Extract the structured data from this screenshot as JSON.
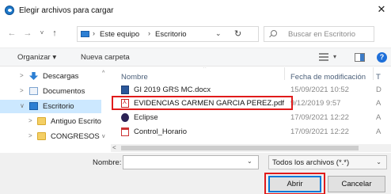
{
  "window": {
    "title": "Elegir archivos para cargar",
    "close_glyph": "✕",
    "icon": "chrome-icon"
  },
  "navigation": {
    "back_glyph": "←",
    "forward_glyph": "→",
    "recent_glyph": "˅",
    "up_glyph": "↑",
    "breadcrumb": [
      "Este equipo",
      "Escritorio"
    ],
    "separator": "›",
    "dropdown_glyph": "⌄",
    "refresh_glyph": "↻",
    "search_placeholder": "Buscar en Escritorio"
  },
  "toolbar": {
    "organize": "Organizar ▾",
    "new_folder": "Nueva carpeta",
    "view_dropdown": "▾",
    "help": "?"
  },
  "sidebar": {
    "items": [
      {
        "label": "Descargas",
        "icon": "download-icon"
      },
      {
        "label": "Documentos",
        "icon": "documents-icon"
      },
      {
        "label": "Escritorio",
        "icon": "desktop-icon",
        "selected": true
      },
      {
        "label": "Antiguo Escrito",
        "icon": "folder-icon"
      },
      {
        "label": "CONGRESOS",
        "icon": "folder-icon"
      }
    ],
    "chevron": ">",
    "expanded_chevron": "∨",
    "scroll_up": "^",
    "scroll_down": "v"
  },
  "file_list": {
    "columns": {
      "name": "Nombre",
      "date": "Fecha de modificación",
      "type": "T"
    },
    "sort_caret": "^",
    "rows": [
      {
        "name": "GI 2019 GRS MC.docx",
        "date": "15/09/2021 10:52",
        "type": "D",
        "icon": "word-doc-icon"
      },
      {
        "name": "EVIDENCIAS CARMEN GARCIA PEREZ.pdf",
        "date": "9/12/2019 9:57",
        "type": "A",
        "icon": "pdf-icon",
        "highlighted": true
      },
      {
        "name": "Eclipse",
        "date": "17/09/2021 12:22",
        "type": "A",
        "icon": "eclipse-icon"
      },
      {
        "name": "Control_Horario",
        "date": "17/09/2021 12:22",
        "type": "A",
        "icon": "spreadsheet-icon"
      }
    ],
    "hscroll_left": "<"
  },
  "footer": {
    "name_label": "Nombre:",
    "name_value": "",
    "name_dropdown": "⌄",
    "filter_value": "Todos los archivos (*.*)",
    "filter_dropdown": "⌄",
    "open_label": "Abrir",
    "cancel_label": "Cancelar"
  },
  "colors": {
    "highlight_box": "#e01b1b",
    "selected_nav": "#cce8ff",
    "accent": "#0078d7"
  }
}
